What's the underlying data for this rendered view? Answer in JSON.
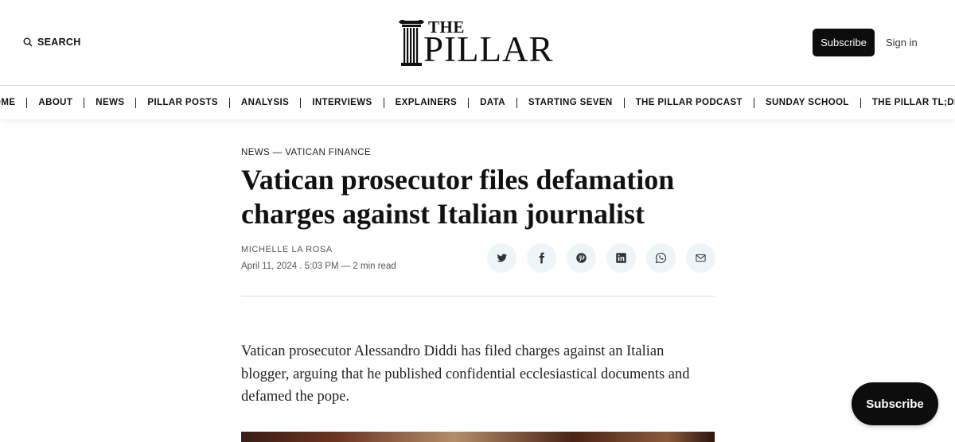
{
  "header": {
    "search_label": "SEARCH",
    "logo": {
      "the": "THE",
      "pillar": "PILLAR"
    },
    "subscribe_label": "Subscribe",
    "signin_label": "Sign in"
  },
  "nav": {
    "items": [
      {
        "label": "OME"
      },
      {
        "label": "ABOUT"
      },
      {
        "label": "NEWS"
      },
      {
        "label": "PILLAR POSTS"
      },
      {
        "label": "ANALYSIS"
      },
      {
        "label": "INTERVIEWS"
      },
      {
        "label": "EXPLAINERS"
      },
      {
        "label": "DATA"
      },
      {
        "label": "STARTING SEVEN"
      },
      {
        "label": "THE PILLAR PODCAST"
      },
      {
        "label": "SUNDAY SCHOOL"
      },
      {
        "label": "THE PILLAR TL;DR"
      }
    ]
  },
  "article": {
    "kicker": {
      "section": "NEWS",
      "separator": "—",
      "tag": "VATICAN FINANCE"
    },
    "title": "Vatican prosecutor files defamation charges against Italian journalist",
    "author": "MICHELLE LA ROSA",
    "meta": "April 11, 2024 . 5:03 PM — 2 min read",
    "share_icons": [
      "twitter-icon",
      "facebook-icon",
      "pinterest-icon",
      "linkedin-icon",
      "whatsapp-icon",
      "email-icon"
    ],
    "lede": "Vatican prosecutor Alessandro Diddi has filed charges against an Italian blogger, arguing that he published confidential ecclesiastical documents and defamed the pope."
  },
  "floating": {
    "subscribe_label": "Subscribe"
  },
  "colors": {
    "button_bg": "#0d0d0d",
    "share_bg": "#eef5f8",
    "text": "#111111"
  }
}
